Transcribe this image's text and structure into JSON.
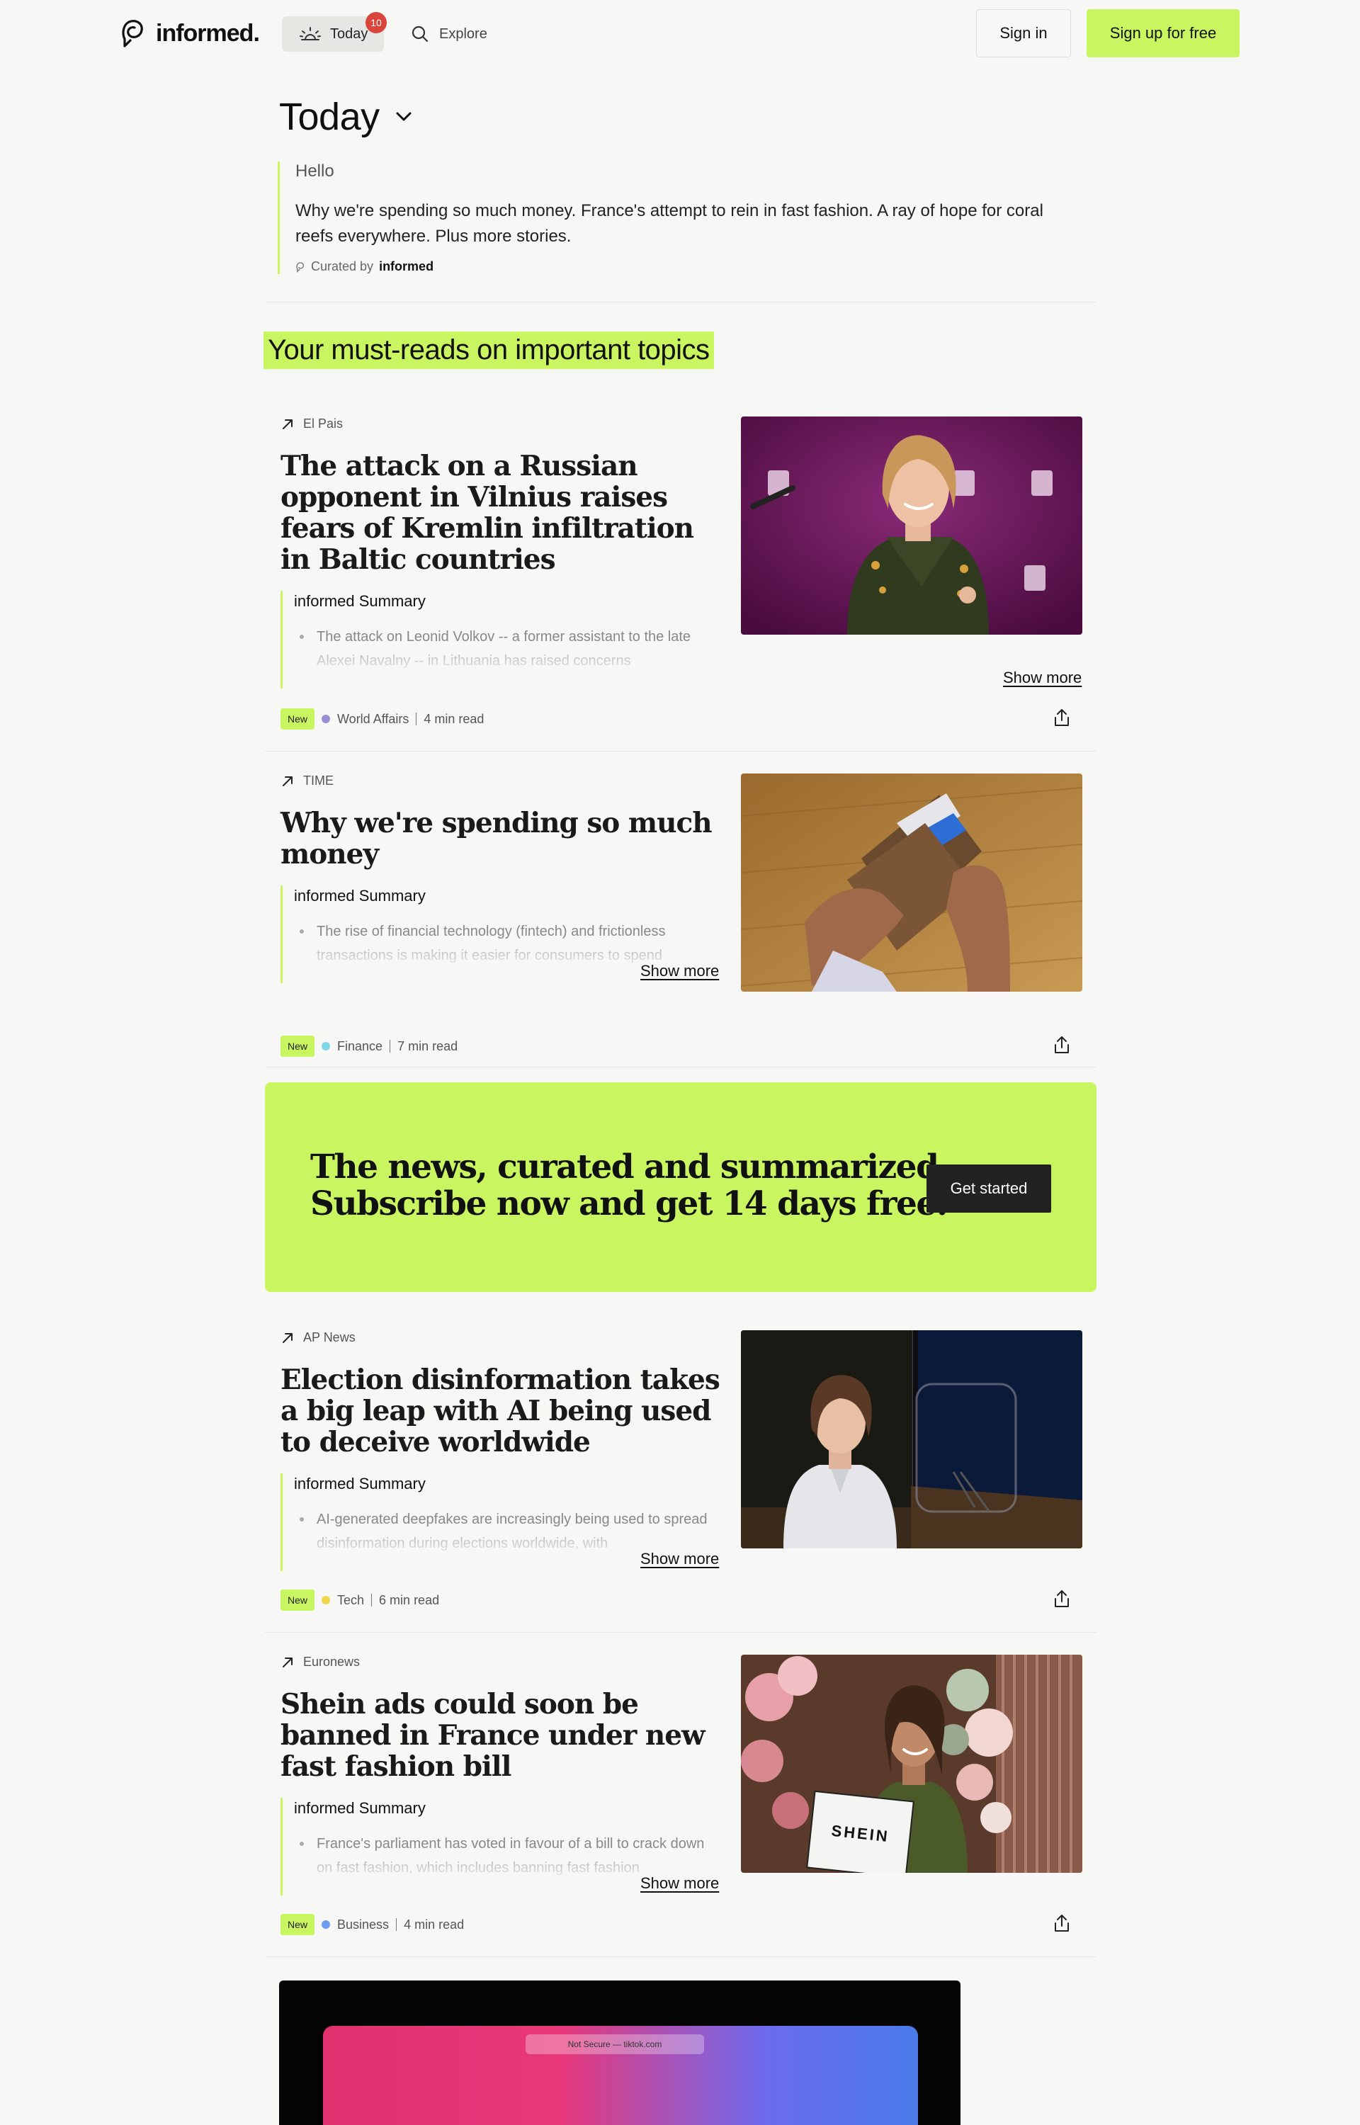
{
  "header": {
    "logo_text": "informed.",
    "nav_today": "Today",
    "today_badge": "10",
    "nav_explore": "Explore",
    "signin": "Sign in",
    "signup": "Sign up for free"
  },
  "intro": {
    "title": "Today",
    "hello": "Hello",
    "body": "Why we're spending so much money. France's attempt to rein in fast fashion. A ray of hope for coral reefs everywhere. Plus more stories.",
    "curated_prefix": "Curated by",
    "curated_brand": "informed"
  },
  "section_title": "Your must-reads on important topics",
  "summary_label": "informed Summary",
  "show_more": "Show more",
  "new_label": "New",
  "articles": [
    {
      "source": "El Pais",
      "headline": "The attack on a Russian opponent in Vilnius raises fears of Kremlin infiltration in Baltic countries",
      "summary": "The attack on Leonid Volkov -- a former assistant to the late Alexei Navalny -- in Lithuania has raised concerns",
      "category": "World Affairs",
      "category_color": "#9b8fd4",
      "read_time": "4 min read"
    },
    {
      "source": "TIME",
      "headline": "Why we're spending so much money",
      "summary": "The rise of financial technology (fintech) and frictionless transactions is making it easier for consumers to spend",
      "category": "Finance",
      "category_color": "#7fd6e8",
      "read_time": "7 min read"
    },
    {
      "source": "AP News",
      "headline": "Election disinformation takes a big leap with AI being used to deceive worldwide",
      "summary": "AI-generated deepfakes are increasingly being used to spread disinformation during elections worldwide, with",
      "category": "Tech",
      "category_color": "#f0d84a",
      "read_time": "6 min read"
    },
    {
      "source": "Euronews",
      "headline": "Shein ads could soon be banned in France under new fast fashion bill",
      "summary": "France's parliament has voted in favour of a bill to crack down on fast fashion, which includes banning fast fashion",
      "category": "Business",
      "category_color": "#6d9cf0",
      "read_time": "4 min read"
    }
  ],
  "cta": {
    "line1": "The news, curated and summarized.",
    "line2": "Subscribe now and get 14 days free.",
    "button": "Get started"
  },
  "bottom_preview": {
    "address_bar": "Not Secure — tiktok.com"
  },
  "image_text": {
    "shein_bag": "SHEIN"
  },
  "colors": {
    "accent": "#c8f560",
    "badge_red": "#d9453a",
    "background": "#f7f7f5"
  }
}
